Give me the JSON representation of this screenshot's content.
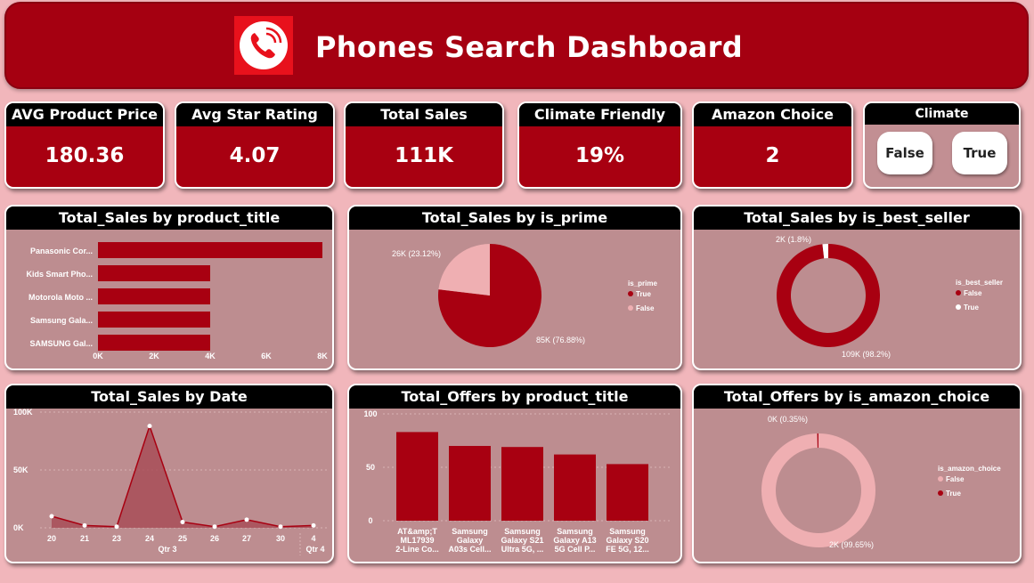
{
  "header": {
    "title": "Phones Search Dashboard",
    "logo_icon": "phone-call-icon"
  },
  "kpis": [
    {
      "label": "AVG Product Price",
      "value": "180.36"
    },
    {
      "label": "Avg Star Rating",
      "value": "4.07"
    },
    {
      "label": "Total Sales",
      "value": "111K"
    },
    {
      "label": "Climate Friendly",
      "value": "19%"
    },
    {
      "label": "Amazon Choice",
      "value": "2"
    }
  ],
  "slicer": {
    "title": "Climate",
    "options": [
      "False",
      "True"
    ]
  },
  "colors": {
    "dark_red": "#a80011",
    "pink": "#efafb2",
    "panel_bg": "#bd8d90",
    "page_bg": "#f1b6bb",
    "white": "#ffffff"
  },
  "chart_data": [
    {
      "type": "bar",
      "orientation": "horizontal",
      "title": "Total_Sales by product_title",
      "categories": [
        "Panasonic Cor...",
        "Kids Smart Pho...",
        "Motorola Moto ...",
        "Samsung Gala...",
        "SAMSUNG Gal..."
      ],
      "values": [
        8000,
        4000,
        4000,
        4000,
        4000
      ],
      "xticks": [
        "0K",
        "2K",
        "4K",
        "6K",
        "8K"
      ],
      "xlim": [
        0,
        8000
      ]
    },
    {
      "type": "pie",
      "title": "Total_Sales by is_prime",
      "legend_title": "is_prime",
      "slices": [
        {
          "name": "True",
          "label": "85K (76.88%)",
          "percent": 76.88,
          "color": "#a80011"
        },
        {
          "name": "False",
          "label": "26K (23.12%)",
          "percent": 23.12,
          "color": "#efafb2"
        }
      ]
    },
    {
      "type": "pie",
      "donut": true,
      "title": "Total_Sales by is_best_seller",
      "legend_title": "is_best_seller",
      "slices": [
        {
          "name": "False",
          "label": "109K (98.2%)",
          "percent": 98.2,
          "color": "#a80011"
        },
        {
          "name": "True",
          "label": "2K (1.8%)",
          "percent": 1.8,
          "color": "#ffffff"
        }
      ]
    },
    {
      "type": "area",
      "title": "Total_Sales by Date",
      "x": [
        "20",
        "21",
        "23",
        "24",
        "25",
        "26",
        "27",
        "30",
        "4"
      ],
      "values": [
        10000,
        2000,
        1000,
        88000,
        5000,
        1000,
        7000,
        1000,
        2000
      ],
      "yticks": [
        "0K",
        "50K",
        "100K"
      ],
      "ylim": [
        0,
        100000
      ],
      "groups": [
        "Qtr 3",
        "Qtr 4"
      ]
    },
    {
      "type": "bar",
      "title": "Total_Offers by product_title",
      "categories": [
        [
          "AT&amp;T",
          "ML17939",
          "2-Line Co..."
        ],
        [
          "Samsung",
          "Galaxy",
          "A03s Cell..."
        ],
        [
          "Samsung",
          "Galaxy S21",
          "Ultra 5G, ..."
        ],
        [
          "Samsung",
          "Galaxy A13",
          "5G Cell P..."
        ],
        [
          "Samsung",
          "Galaxy S20",
          "FE 5G, 12..."
        ]
      ],
      "values": [
        83,
        70,
        69,
        62,
        53
      ],
      "yticks": [
        "0",
        "50",
        "100"
      ],
      "ylim": [
        0,
        100
      ]
    },
    {
      "type": "pie",
      "donut": true,
      "title": "Total_Offers by is_amazon_choice",
      "legend_title": "is_amazon_choice",
      "slices": [
        {
          "name": "False",
          "label": "2K (99.65%)",
          "percent": 99.65,
          "color": "#efafb2"
        },
        {
          "name": "True",
          "label": "0K (0.35%)",
          "percent": 0.35,
          "color": "#a80011"
        }
      ]
    }
  ]
}
